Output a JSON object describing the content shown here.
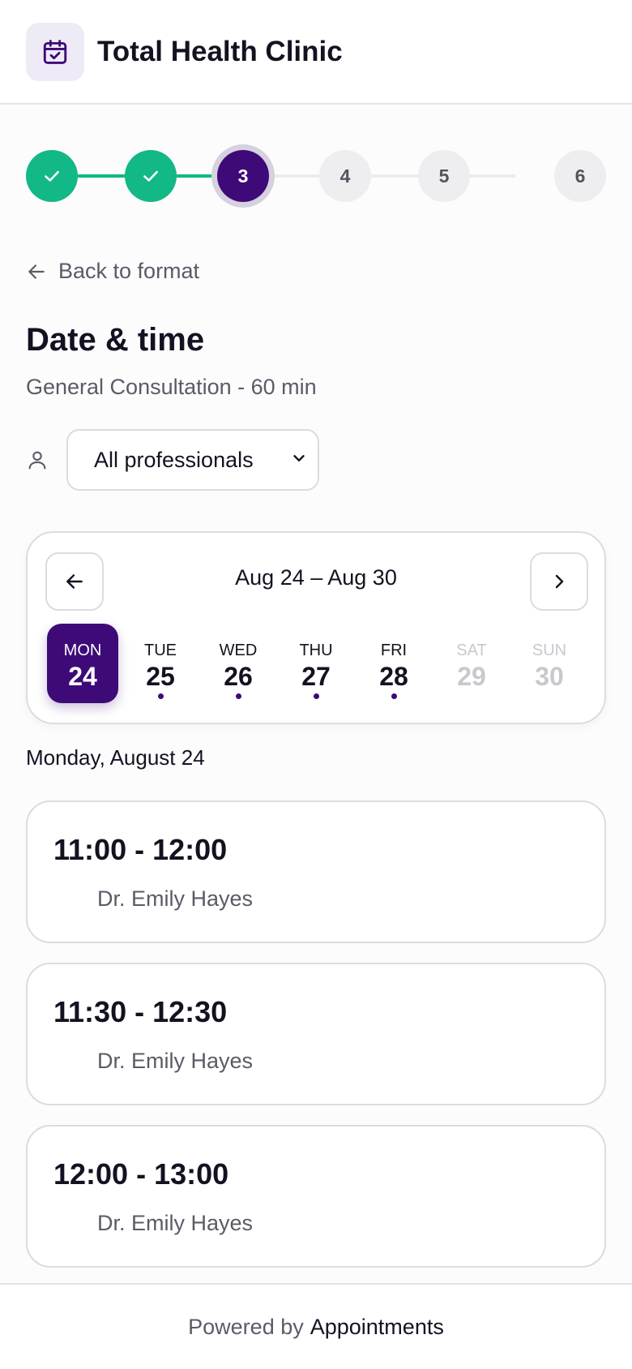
{
  "header": {
    "clinic_name": "Total Health Clinic",
    "logo_icon": "calendar-check-icon"
  },
  "stepper": {
    "current_step": 3,
    "steps": [
      {
        "label": "",
        "status": "done"
      },
      {
        "label": "",
        "status": "done"
      },
      {
        "label": "3",
        "status": "current"
      },
      {
        "label": "4",
        "status": "todo"
      },
      {
        "label": "5",
        "status": "todo"
      },
      {
        "label": "6",
        "status": "todo"
      }
    ]
  },
  "back_link": {
    "label": "Back to format"
  },
  "page": {
    "title": "Date & time",
    "subtitle": "General Consultation - 60 min"
  },
  "filter": {
    "selected": "All professionals"
  },
  "calendar": {
    "range": "Aug 24 – Aug 30",
    "days": [
      {
        "name": "MON",
        "num": "24",
        "state": "selected"
      },
      {
        "name": "TUE",
        "num": "25",
        "state": "available"
      },
      {
        "name": "WED",
        "num": "26",
        "state": "available"
      },
      {
        "name": "THU",
        "num": "27",
        "state": "available"
      },
      {
        "name": "FRI",
        "num": "28",
        "state": "available"
      },
      {
        "name": "SAT",
        "num": "29",
        "state": "disabled"
      },
      {
        "name": "SUN",
        "num": "30",
        "state": "disabled"
      }
    ]
  },
  "selected_date_label": "Monday, August 24",
  "slots": [
    {
      "time": "11:00 - 12:00",
      "doctor": "Dr. Emily Hayes"
    },
    {
      "time": "11:30 - 12:30",
      "doctor": "Dr. Emily Hayes"
    },
    {
      "time": "12:00 - 13:00",
      "doctor": "Dr. Emily Hayes"
    }
  ],
  "footer": {
    "prefix": "Powered by",
    "brand": "Appointments"
  },
  "colors": {
    "accent": "#3d0a78",
    "success": "#12b886"
  }
}
